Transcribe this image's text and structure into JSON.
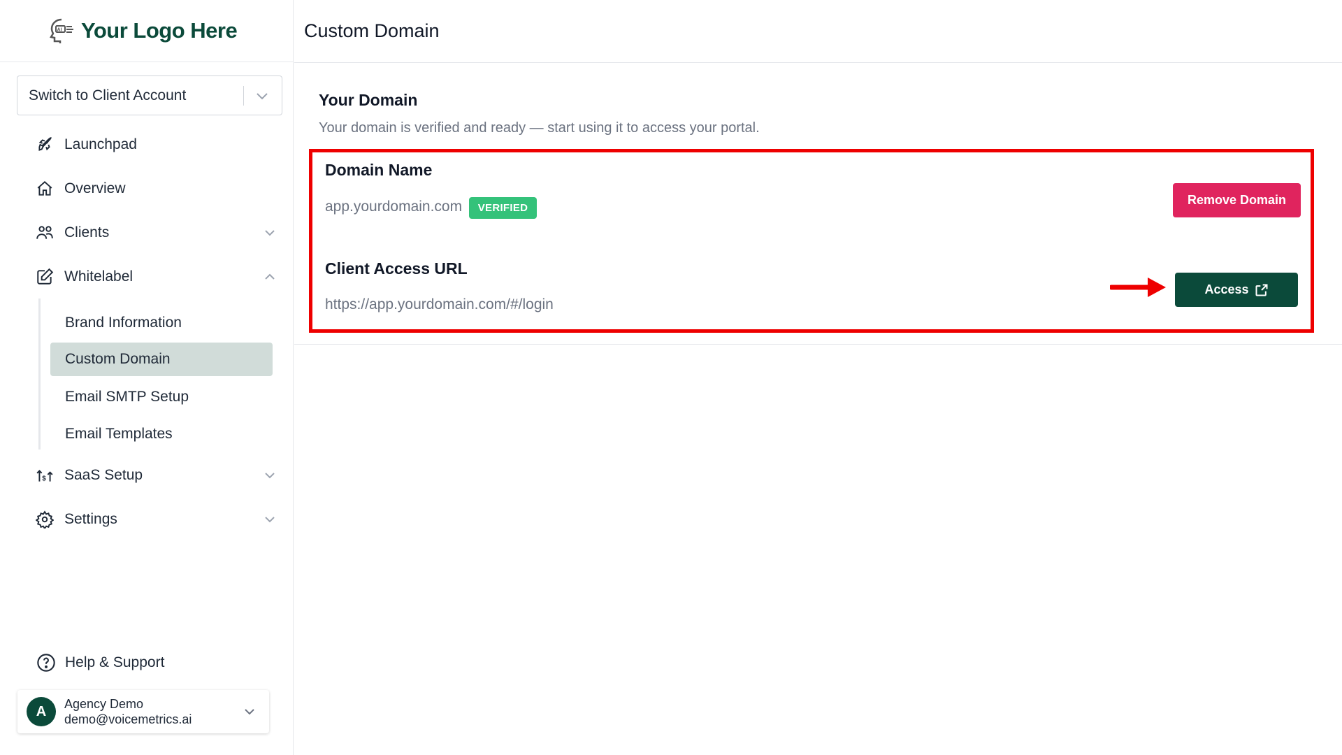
{
  "brand": {
    "logo_text": "Your Logo Here",
    "logo_icon": "ai-head-icon",
    "accent": "#0b4a3a"
  },
  "sidebar": {
    "switch_account": {
      "label": "Switch to Client Account"
    },
    "items": [
      {
        "label": "Launchpad",
        "icon": "rocket-icon"
      },
      {
        "label": "Overview",
        "icon": "home-icon"
      },
      {
        "label": "Clients",
        "icon": "users-icon",
        "expandable": true
      },
      {
        "label": "Whitelabel",
        "icon": "edit-icon",
        "expanded": true
      },
      {
        "label": "SaaS Setup",
        "icon": "saas-icon",
        "expandable": true
      },
      {
        "label": "Settings",
        "icon": "gear-icon",
        "expandable": true
      }
    ],
    "whitelabel_sub": [
      {
        "label": "Brand Information"
      },
      {
        "label": "Custom Domain",
        "active": true
      },
      {
        "label": "Email SMTP Setup"
      },
      {
        "label": "Email Templates"
      }
    ],
    "help": {
      "label": "Help & Support",
      "icon": "help-circle-icon"
    },
    "account": {
      "initial": "A",
      "name": "Agency Demo",
      "email": "demo@voicemetrics.ai"
    }
  },
  "header": {
    "title": "Custom Domain"
  },
  "domain": {
    "section_title": "Your Domain",
    "section_desc": "Your domain is verified and ready — start using it to access your portal.",
    "domain_name_label": "Domain Name",
    "domain_value": "app.yourdomain.com",
    "status_badge": "VERIFIED",
    "status_color": "#34c27a",
    "remove_button": "Remove Domain",
    "remove_color": "#e0245e",
    "access_url_label": "Client Access URL",
    "access_url_value": "https://app.yourdomain.com/#/login",
    "access_button": "Access",
    "highlight_color": "#ee0000"
  }
}
